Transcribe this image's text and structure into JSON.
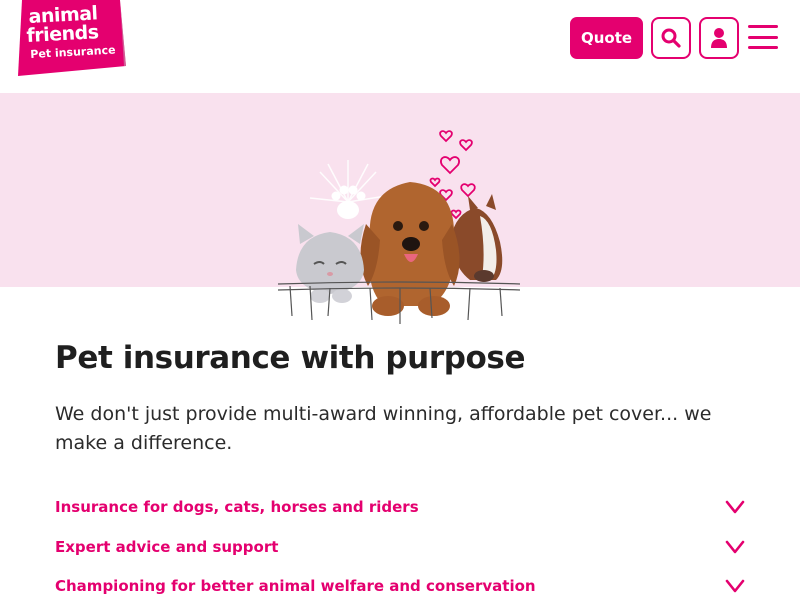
{
  "brand": {
    "line1": "animal",
    "line2": "friends",
    "line3": "Pet insurance",
    "color": "#e4006f"
  },
  "header": {
    "quote_label": "Quote",
    "search_icon": "search-icon",
    "account_icon": "user-icon",
    "menu_icon": "hamburger-menu-icon"
  },
  "hero": {
    "background": "#f9e1ee",
    "image": "cat-dog-horse-illustration"
  },
  "main": {
    "title": "Pet insurance with purpose",
    "lead": "We don't just provide multi-award winning, affordable pet cover... we make a difference.",
    "items": [
      {
        "label": "Insurance for dogs, cats, horses and riders"
      },
      {
        "label": "Expert advice and support"
      },
      {
        "label": "Championing for better animal welfare and conservation"
      }
    ]
  }
}
